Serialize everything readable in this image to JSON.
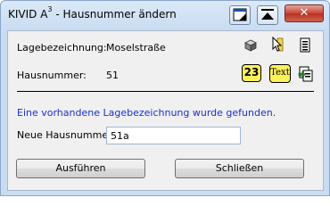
{
  "window": {
    "title_main": "KIVID A",
    "title_sup": "3",
    "title_rest": " - Hausnummer ändern",
    "close_glyph": "✕"
  },
  "fields": {
    "lagebezeichnung_label": "Lagebezeichnung:",
    "lagebezeichnung_value": "Moselstraße",
    "hausnummer_label": "Hausnummer:",
    "hausnummer_value": "51"
  },
  "icons": {
    "number_badge": "23",
    "text_badge": "Text"
  },
  "info_message": "Eine vorhandene Lagebezeichnung wurde gefunden.",
  "new_number": {
    "label": "Neue Hausnummer:",
    "value": "51a"
  },
  "buttons": {
    "execute": "Ausführen",
    "close": "Schließen"
  }
}
